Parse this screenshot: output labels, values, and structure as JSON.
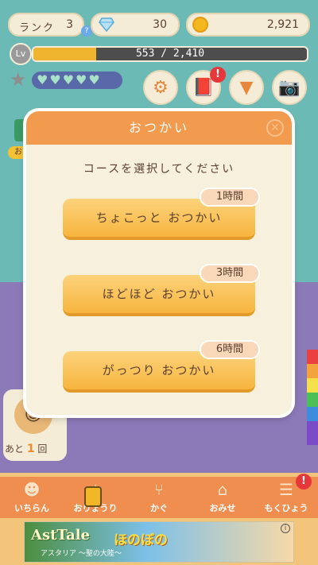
{
  "status": {
    "rank_label": "ランク",
    "rank_value": "3",
    "rank_badge": "?",
    "gems": "30",
    "coins": "2,921"
  },
  "xp": {
    "current": "553",
    "max": "2,410",
    "display": "553 / 2,410",
    "progress_fraction": 0.229
  },
  "hearts": {
    "filled": 5,
    "total": 5
  },
  "tools": [
    {
      "name": "settings",
      "icon": "gear-icon"
    },
    {
      "name": "book",
      "icon": "book-icon",
      "alert": "!"
    },
    {
      "name": "shop-stand",
      "icon": "stand-icon"
    },
    {
      "name": "camera",
      "icon": "camera-icon"
    }
  ],
  "side": {
    "tag": "お"
  },
  "remaining": {
    "prefix": "あと",
    "count": "1",
    "suffix": "回"
  },
  "modal": {
    "title": "おつかい",
    "close_icon": "close-icon",
    "prompt": "コースを選択してください",
    "courses": [
      {
        "label": "ちょこっと おつかい",
        "time": "1時間"
      },
      {
        "label": "ほどほど おつかい",
        "time": "3時間"
      },
      {
        "label": "がっつり おつかい",
        "time": "6時間"
      }
    ]
  },
  "nav": {
    "items": [
      {
        "label": "いちらん",
        "icon": "character-icon"
      },
      {
        "label": "おりょうり",
        "icon": "cooking-icon",
        "locked": true
      },
      {
        "label": "かぐ",
        "icon": "chair-icon"
      },
      {
        "label": "おみせ",
        "icon": "store-icon"
      },
      {
        "label": "もくひょう",
        "icon": "list-icon",
        "alert": "!"
      }
    ]
  },
  "ad": {
    "title": "AstTale",
    "subtitle": "アスタリア ～聖の大陸～",
    "logo": "ほのぼの",
    "info": "i"
  },
  "colors": {
    "accent_orange": "#f29a4e",
    "button_yellow": "#f7b540",
    "bg_teal": "#6cbab5",
    "bg_purple": "#8b79b8",
    "xp_fill": "#efb52e",
    "alert_red": "#e6383a"
  }
}
